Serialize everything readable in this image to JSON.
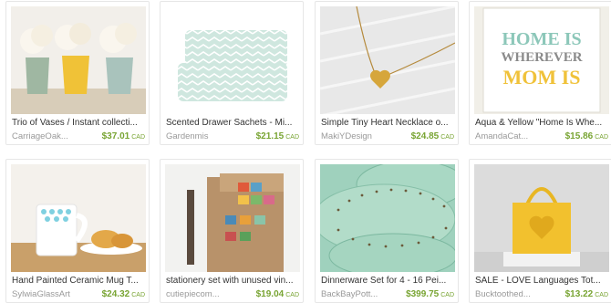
{
  "listings": [
    {
      "title": "Trio of Vases / Instant collecti...",
      "shop": "CarriageOak...",
      "price": "$37.01",
      "currency": "CAD",
      "image_icon": "vases-image"
    },
    {
      "title": "Scented Drawer Sachets - Mi...",
      "shop": "Gardenmis",
      "price": "$21.15",
      "currency": "CAD",
      "image_icon": "sachets-image"
    },
    {
      "title": "Simple Tiny Heart Necklace o...",
      "shop": "MakiYDesign",
      "price": "$24.85",
      "currency": "CAD",
      "image_icon": "necklace-image"
    },
    {
      "title": "Aqua & Yellow \"Home Is Whe...",
      "shop": "AmandaCat...",
      "price": "$15.86",
      "currency": "CAD",
      "image_icon": "print-image"
    },
    {
      "title": "Hand Painted Ceramic Mug T...",
      "shop": "SylwiaGlassArt",
      "price": "$24.32",
      "currency": "CAD",
      "image_icon": "mug-image"
    },
    {
      "title": "stationery set with unused vin...",
      "shop": "cutiepiecom...",
      "price": "$19.04",
      "currency": "CAD",
      "image_icon": "stationery-image"
    },
    {
      "title": "Dinnerware Set for 4 - 16 Pei...",
      "shop": "BackBayPott...",
      "price": "$399.75",
      "currency": "CAD",
      "image_icon": "dinnerware-image"
    },
    {
      "title": "SALE - LOVE Languages Tot...",
      "shop": "Bucktoothed...",
      "price": "$13.22",
      "currency": "CAD",
      "image_icon": "tote-image"
    }
  ],
  "print_text": {
    "line1": "HOME IS",
    "line2": "WHEREVER",
    "line3": "MOM IS"
  },
  "colors": {
    "price": "#78a432",
    "shop": "#999999",
    "title": "#333333",
    "border": "#e6e6e6"
  }
}
